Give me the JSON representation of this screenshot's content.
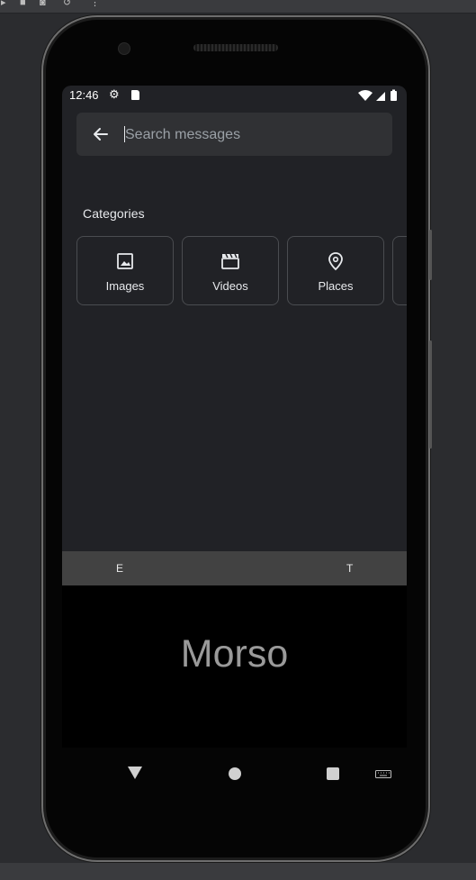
{
  "status_bar": {
    "time": "12:46"
  },
  "search": {
    "placeholder": "Search messages",
    "value": ""
  },
  "categories": {
    "title": "Categories",
    "items": [
      {
        "label": "Images",
        "icon": "image-icon"
      },
      {
        "label": "Videos",
        "icon": "video-clapper-icon"
      },
      {
        "label": "Places",
        "icon": "location-pin-icon"
      }
    ]
  },
  "keyboard_bar": {
    "left_key": "E",
    "right_key": "T"
  },
  "ime": {
    "word": "Morso"
  },
  "colors": {
    "screen_bg": "#212226",
    "search_bg": "#303134",
    "text": "#e8eaed",
    "chip_border": "#4a4c50"
  }
}
